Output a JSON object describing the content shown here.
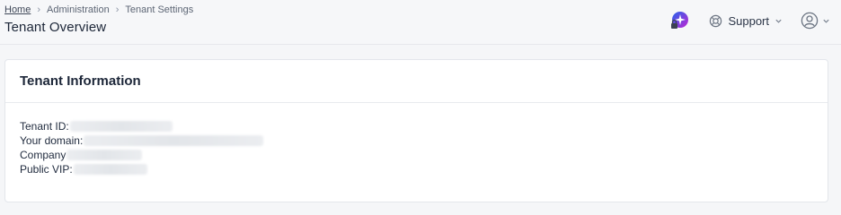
{
  "breadcrumb": {
    "items": [
      {
        "label": "Home"
      },
      {
        "label": "Administration"
      },
      {
        "label": "Tenant Settings"
      }
    ]
  },
  "header": {
    "title": "Tenant Overview",
    "support_label": "Support"
  },
  "card": {
    "title": "Tenant Information",
    "fields": [
      {
        "label": "Tenant ID:"
      },
      {
        "label": "Your domain:"
      },
      {
        "label": "Company"
      },
      {
        "label": "Public VIP:"
      }
    ]
  },
  "icons": {
    "ai": "ai-sparkle-lock-icon",
    "support": "lifebuoy-icon",
    "profile": "user-circle-icon",
    "chevron": "chevron-down-icon",
    "separator": "chevron-right-icon"
  },
  "colors": {
    "accent": "#4f46e5",
    "ai_gradient_start": "#2563eb",
    "ai_gradient_end": "#c026d3"
  }
}
